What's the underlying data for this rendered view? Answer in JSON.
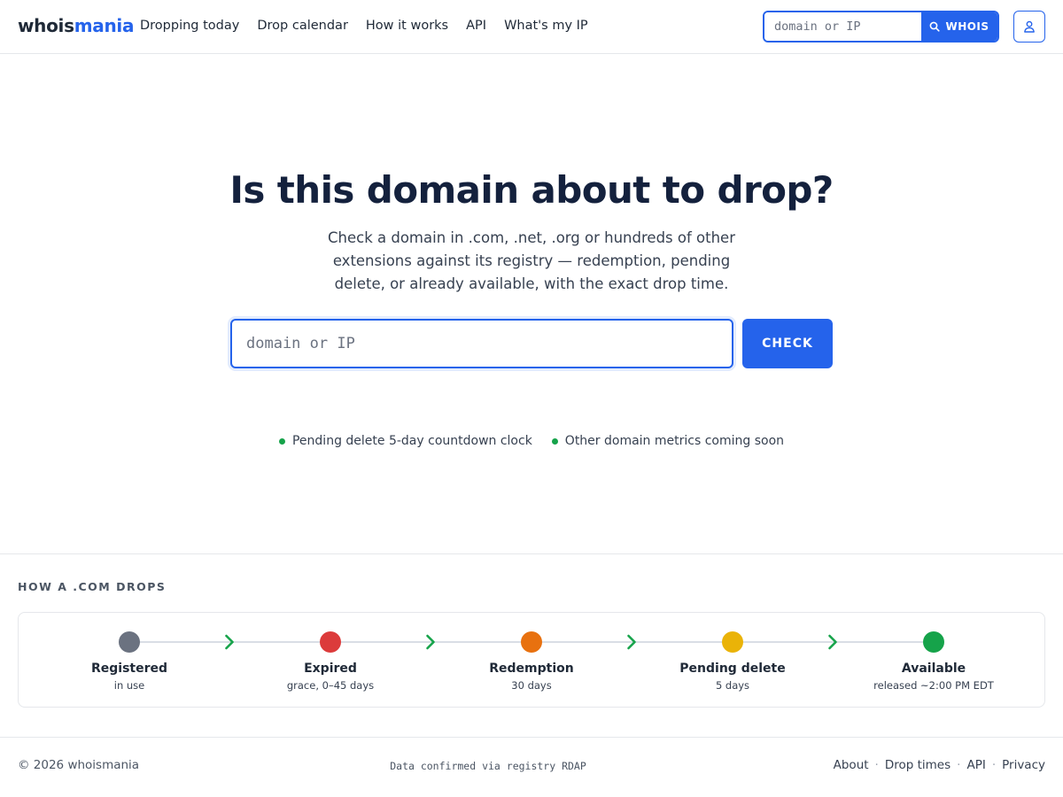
{
  "header": {
    "logo_part1": "whois",
    "logo_part2": "mania",
    "nav": [
      "Dropping today",
      "Drop calendar",
      "How it works",
      "API",
      "What's my IP"
    ],
    "search_placeholder": "domain or IP",
    "search_button": "WHOIS",
    "search_icon": "search-icon",
    "account_icon": "user-icon"
  },
  "hero": {
    "title": "Is this domain about to drop?",
    "subtitle": "Check a domain in .com, .net, .org or hundreds of other extensions against its registry — redemption, pending delete, or already available, with the exact drop time.",
    "input_placeholder": "domain or IP",
    "button": "CHECK",
    "features": [
      "Pending delete 5-day countdown clock",
      "Other domain metrics coming soon"
    ]
  },
  "lifecycle": {
    "title": "HOW A .COM DROPS",
    "stages": [
      {
        "label": "Registered",
        "sub": "in use",
        "color": "#6b7280"
      },
      {
        "label": "Expired",
        "sub": "grace, 0–45 days",
        "color": "#dc3b3b"
      },
      {
        "label": "Redemption",
        "sub": "30 days",
        "color": "#e8710f"
      },
      {
        "label": "Pending delete",
        "sub": "5 days",
        "color": "#eab308"
      },
      {
        "label": "Available",
        "sub": "released ~2:00 PM EDT",
        "color": "#16a34a"
      }
    ],
    "arrow_color": "#16a34a",
    "line_color": "#d9dee5"
  },
  "footer": {
    "copyright": "© 2026 whoismania",
    "rdap_note": "Data confirmed via registry RDAP",
    "links": [
      "About",
      "Drop times",
      "API",
      "Privacy"
    ]
  }
}
